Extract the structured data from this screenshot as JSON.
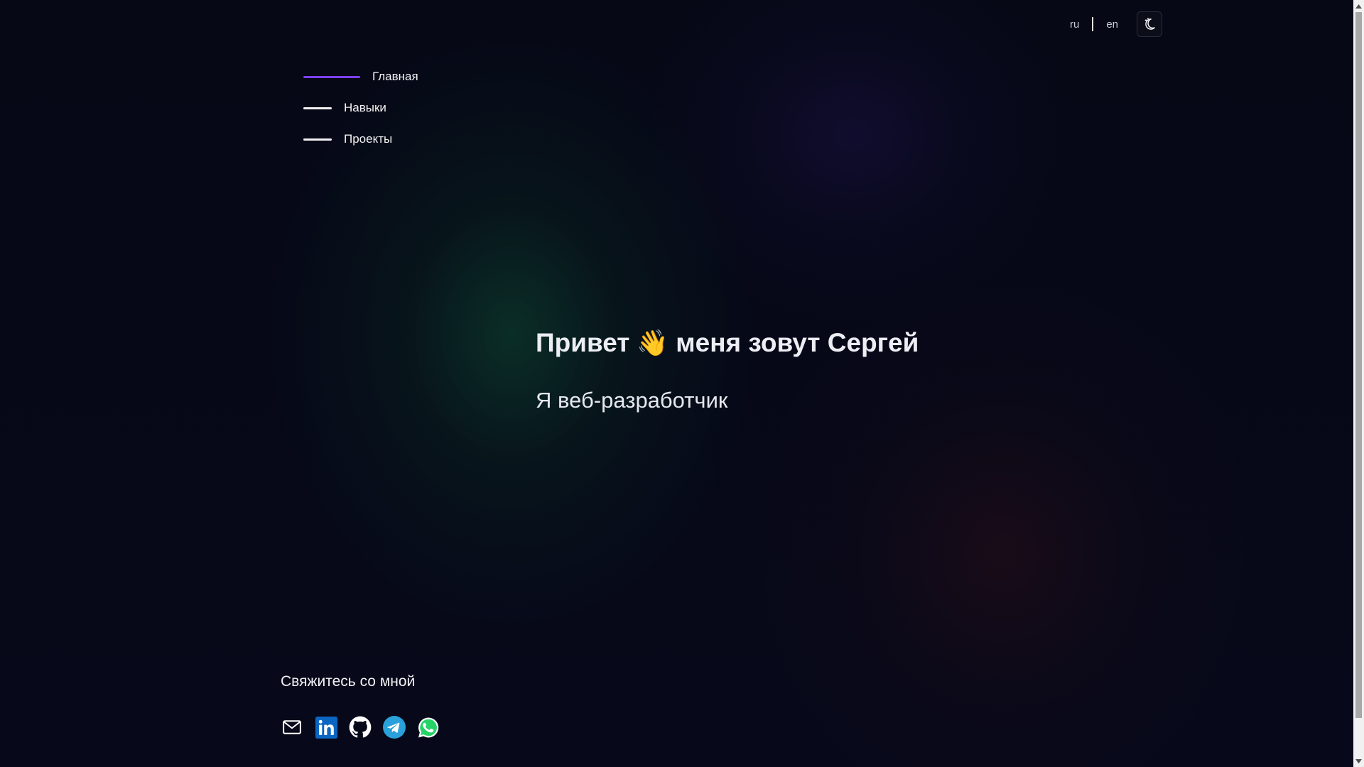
{
  "languages": {
    "ru": "ru",
    "en": "en"
  },
  "theme_toggle": {
    "icon": "moon-stars-icon"
  },
  "nav": {
    "items": [
      {
        "label": "Главная",
        "active": true
      },
      {
        "label": "Навыки",
        "active": false
      },
      {
        "label": "Проекты",
        "active": false
      }
    ]
  },
  "hero": {
    "greeting_before": "Привет",
    "emoji": "👋",
    "greeting_after": "меня зовут Сергей",
    "subtitle": "Я веб-разработчик"
  },
  "contacts": {
    "title": "Свяжитесь со мной",
    "icons": [
      "mail-icon",
      "linkedin-icon",
      "github-icon",
      "telegram-icon",
      "whatsapp-icon"
    ]
  },
  "colors": {
    "accent": "#7b3ff2",
    "background": "#060817",
    "linkedin": "#0a66c2",
    "telegram": "#2aa1da",
    "whatsapp": "#25d366"
  }
}
